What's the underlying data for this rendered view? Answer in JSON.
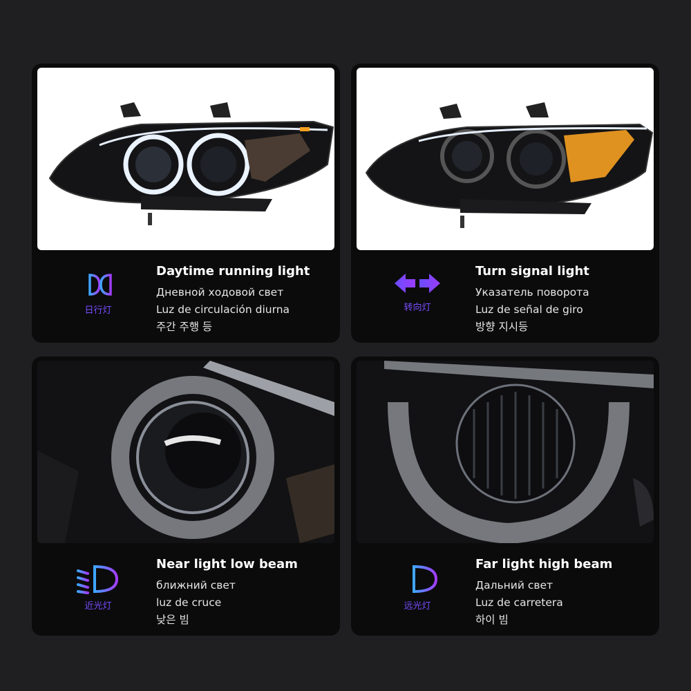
{
  "features": [
    {
      "title": "Daytime running light",
      "lines": [
        "Дневной ходовой свет",
        "Luz de circulación diurna",
        "주간 주행 등"
      ],
      "icon_name": "daytime-running-light-icon",
      "icon_caption": "日行灯"
    },
    {
      "title": "Turn signal light",
      "lines": [
        "Указатель поворота",
        "Luz de señal de giro",
        "방향 지시등"
      ],
      "icon_name": "turn-signal-arrows-icon",
      "icon_caption": "转向灯"
    },
    {
      "title": "Near light low beam",
      "lines": [
        "ближний свет",
        "luz de cruce",
        "낮은 빔"
      ],
      "icon_name": "low-beam-icon",
      "icon_caption": "近光灯"
    },
    {
      "title": "Far light high beam",
      "lines": [
        "Дальний свет",
        "Luz de carretera",
        "하이 빔"
      ],
      "icon_name": "high-beam-icon",
      "icon_caption": "远光灯"
    }
  ],
  "colors": {
    "background": "#1f1f21",
    "card": "#0b0b0c",
    "icon_gradient_start": "#3fa7ff",
    "icon_gradient_end": "#a23cff",
    "caption": "#7a4dff",
    "amber": "#f5a020"
  }
}
